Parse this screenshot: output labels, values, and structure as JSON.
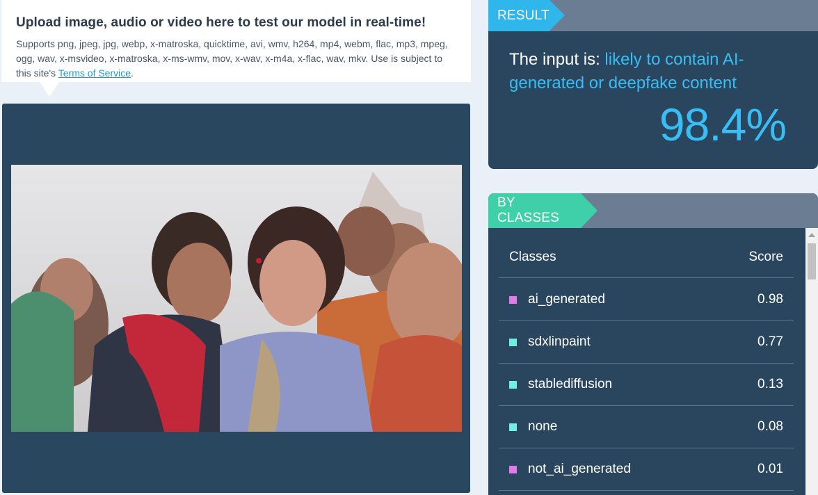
{
  "upload": {
    "title": "Upload image, audio or video here to test our model in real-time!",
    "description": "Supports png, jpeg, jpg, webp, x-matroska, quicktime, avi, wmv, h264, mp4, webm, flac, mp3, mpeg, ogg, wav, x-msvideo, x-matroska, x-ms-wmv, mov, x-wav, x-m4a, x-flac, wav, mkv. Use is subject to this site's ",
    "tos_link": "Terms of Service",
    "suffix": "."
  },
  "result": {
    "header": "RESULT",
    "prefix": "The input is: ",
    "verdict": "likely to contain AI-generated or deepfake content",
    "percentage": "98.4%"
  },
  "classes": {
    "header": "BY CLASSES",
    "column_class": "Classes",
    "column_score": "Score",
    "rows": [
      {
        "name": "ai_generated",
        "score": "0.98",
        "color": "#e07be8"
      },
      {
        "name": "sdxlinpaint",
        "score": "0.77",
        "color": "#6ff0e0"
      },
      {
        "name": "stablediffusion",
        "score": "0.13",
        "color": "#6ff0e0"
      },
      {
        "name": "none",
        "score": "0.08",
        "color": "#6ff0e0"
      },
      {
        "name": "not_ai_generated",
        "score": "0.01",
        "color": "#e07be8"
      }
    ]
  },
  "colors": {
    "accent_blue": "#38bdf4",
    "accent_green": "#3fd0a9",
    "panel_bg": "#29465e"
  }
}
